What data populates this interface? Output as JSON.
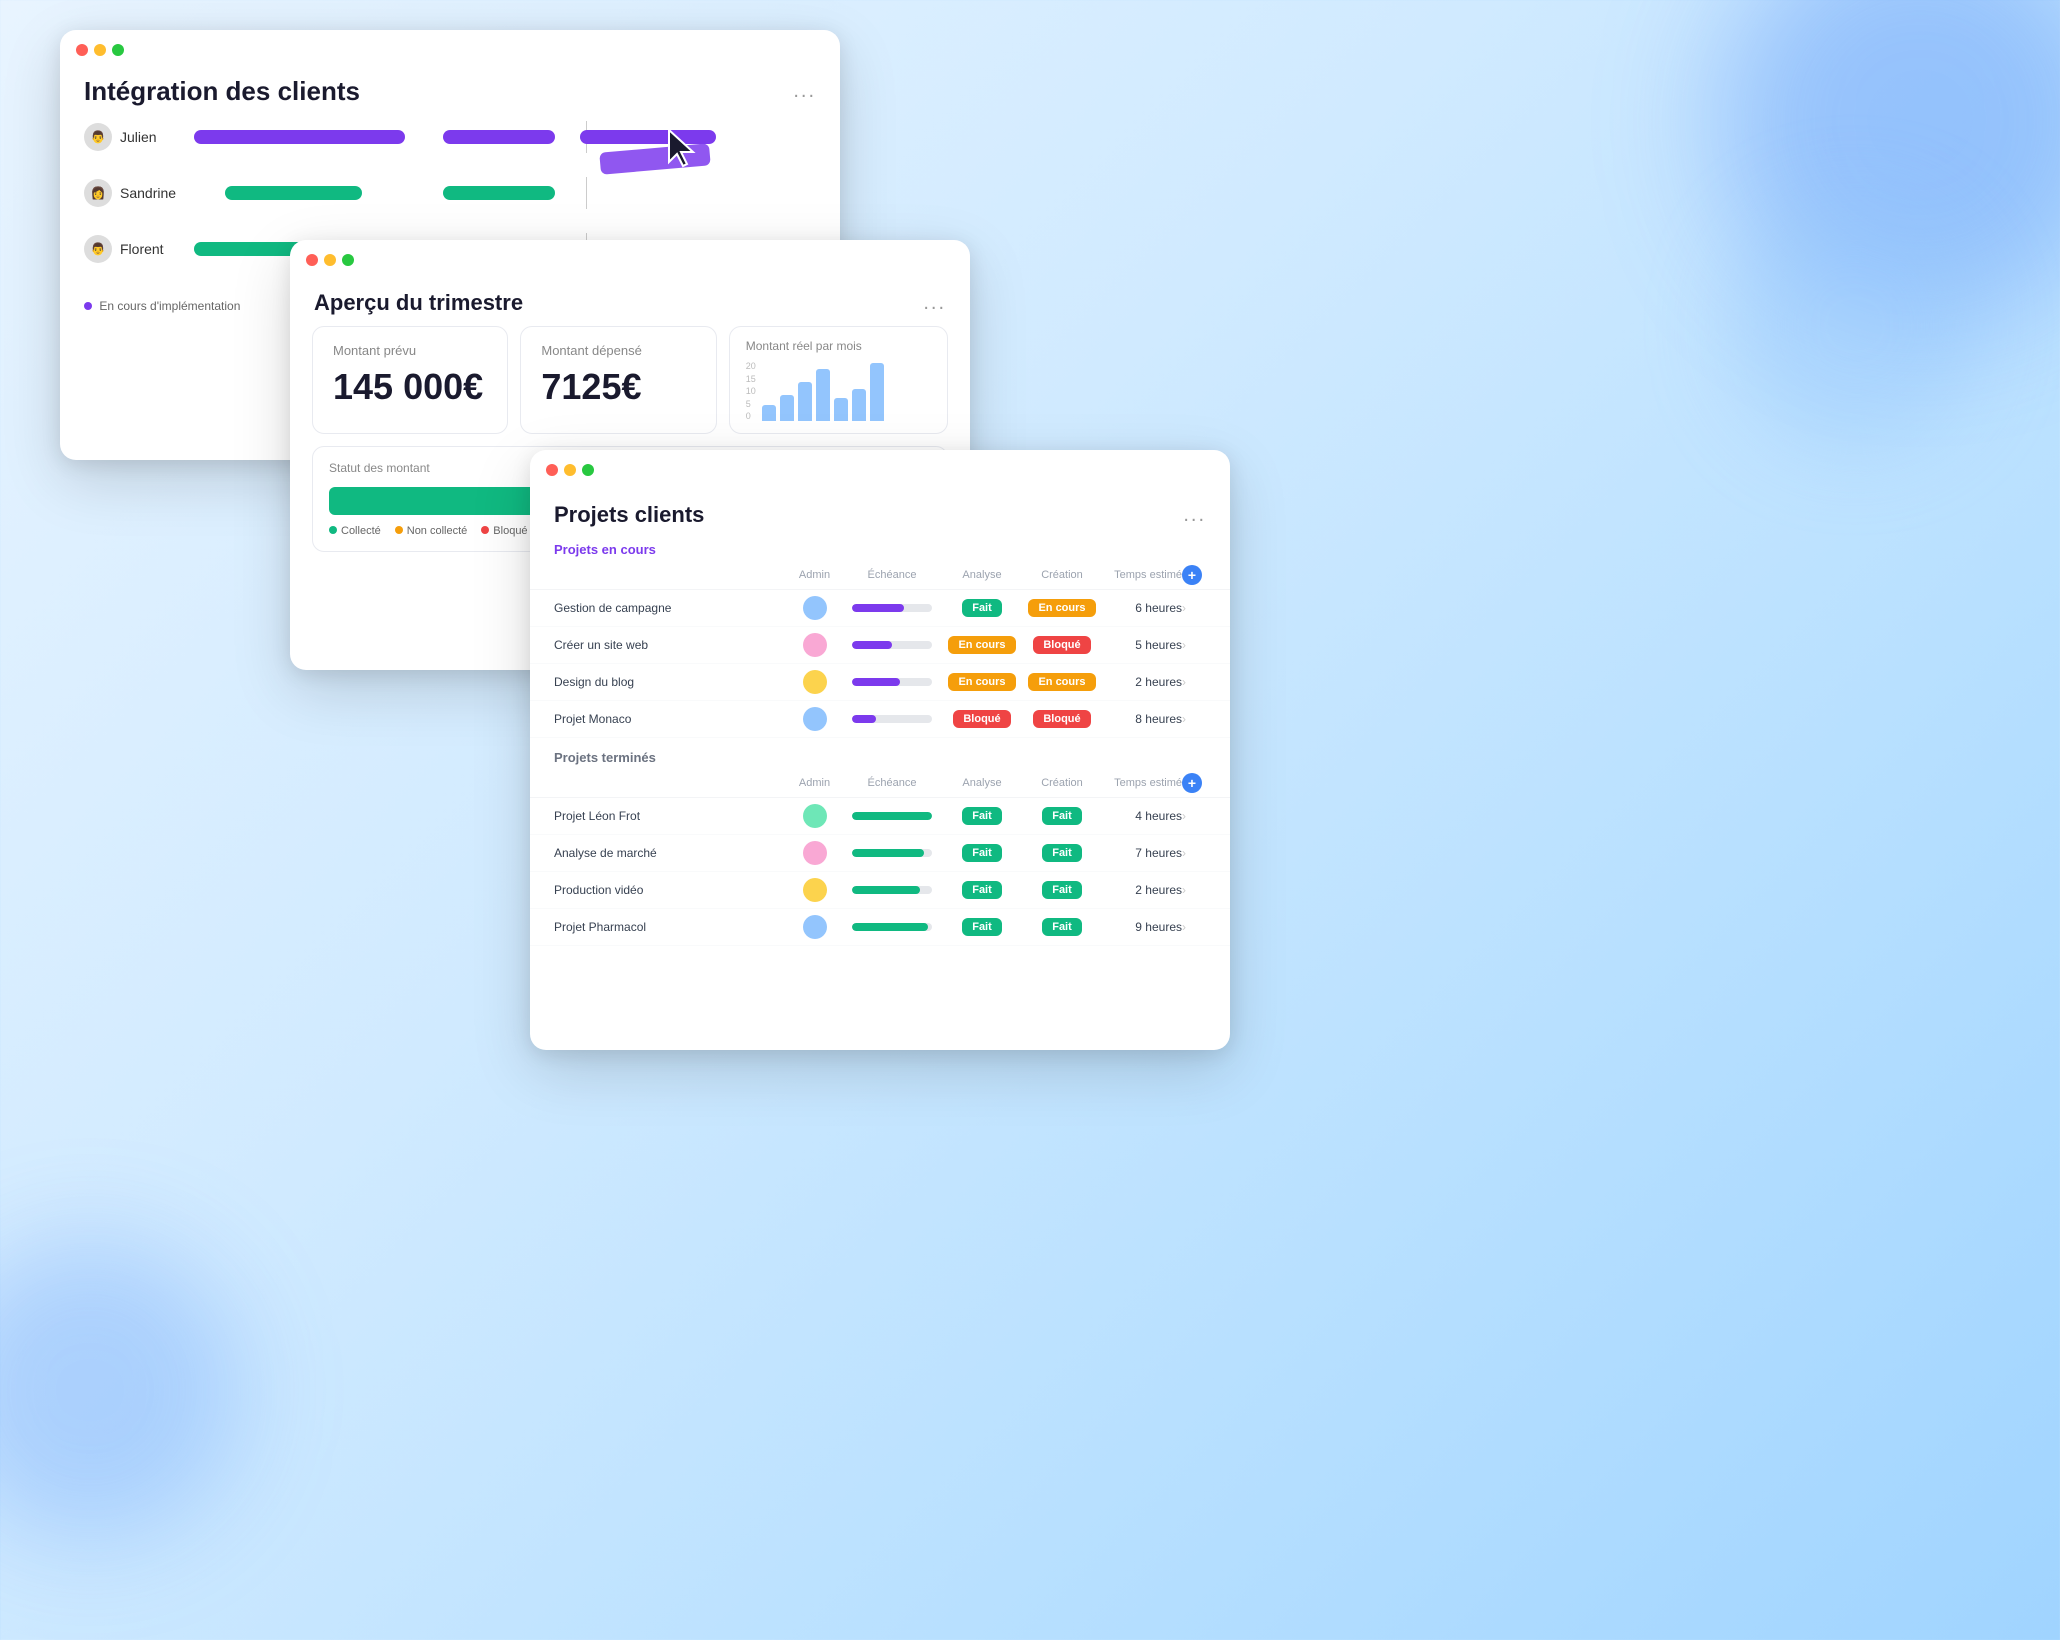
{
  "gantt": {
    "title": "Intégration des clients",
    "more": "...",
    "rows": [
      {
        "name": "Julien",
        "bars": [
          {
            "left": "0%",
            "width": "34%",
            "color": "purple"
          },
          {
            "left": "40%",
            "width": "18%",
            "color": "purple"
          },
          {
            "left": "62%",
            "width": "22%",
            "color": "purple"
          }
        ]
      },
      {
        "name": "Sandrine",
        "bars": [
          {
            "left": "5%",
            "width": "22%",
            "color": "green"
          },
          {
            "left": "40%",
            "width": "18%",
            "color": "green"
          }
        ]
      },
      {
        "name": "Florent",
        "bars": [
          {
            "left": "0%",
            "width": "20%",
            "color": "green"
          }
        ]
      }
    ],
    "legend": [
      {
        "color": "#7c3aed",
        "label": "En cours d'implémentation"
      },
      {
        "color": "#10b981",
        "label": ""
      }
    ]
  },
  "apercu": {
    "title": "Aperçu du trimestre",
    "more": "...",
    "montant_prevu_label": "Montant prévu",
    "montant_prevu_value": "145 000€",
    "montant_depense_label": "Montant dépensé",
    "montant_depense_value": "7125€",
    "chart_label": "Montant réel par mois",
    "chart_bars": [
      5,
      8,
      12,
      16,
      7,
      10,
      18
    ],
    "chart_y_labels": [
      "20",
      "15",
      "10",
      "5",
      "0"
    ],
    "statut_label": "Statut des montant",
    "statut_segments": [
      {
        "color": "green",
        "width": "55%"
      },
      {
        "color": "orange",
        "width": "28%"
      },
      {
        "color": "red",
        "width": "17%"
      }
    ],
    "statut_legend": [
      {
        "color": "#10b981",
        "label": "Collecté"
      },
      {
        "color": "#f59e0b",
        "label": "Non collecté"
      },
      {
        "color": "#ef4444",
        "label": "Bloqué"
      }
    ]
  },
  "projets": {
    "title": "Projets clients",
    "more": "...",
    "columns": [
      "Admin",
      "Échéance",
      "Analyse",
      "Création",
      "Temps estimé"
    ],
    "active_section_label": "Projets en cours",
    "active_rows": [
      {
        "name": "Gestion de campagne",
        "avatar": "blue",
        "echeance_pct": 65,
        "analyse": "Fait",
        "analyse_color": "green",
        "creation": "En cours",
        "creation_color": "orange",
        "temps": "6 heures"
      },
      {
        "name": "Créer un site web",
        "avatar": "pink",
        "echeance_pct": 50,
        "analyse": "En cours",
        "analyse_color": "orange",
        "creation": "Bloqué",
        "creation_color": "red",
        "temps": "5 heures"
      },
      {
        "name": "Design du blog",
        "avatar": "orange",
        "echeance_pct": 60,
        "analyse": "En cours",
        "analyse_color": "orange",
        "creation": "En cours",
        "creation_color": "orange",
        "temps": "2 heures"
      },
      {
        "name": "Projet Monaco",
        "avatar": "blue",
        "echeance_pct": 30,
        "analyse": "Bloqué",
        "analyse_color": "red",
        "creation": "Bloqué",
        "creation_color": "red",
        "temps": "8 heures"
      }
    ],
    "completed_section_label": "Projets terminés",
    "completed_rows": [
      {
        "name": "Projet Léon Frot",
        "avatar": "teal",
        "echeance_pct": 100,
        "analyse": "Fait",
        "analyse_color": "green",
        "creation": "Fait",
        "creation_color": "green",
        "temps": "4 heures"
      },
      {
        "name": "Analyse de marché",
        "avatar": "pink",
        "echeance_pct": 90,
        "analyse": "Fait",
        "analyse_color": "green",
        "creation": "Fait",
        "creation_color": "green",
        "temps": "7 heures"
      },
      {
        "name": "Production vidéo",
        "avatar": "orange",
        "echeance_pct": 85,
        "analyse": "Fait",
        "analyse_color": "green",
        "creation": "Fait",
        "creation_color": "green",
        "temps": "2 heures"
      },
      {
        "name": "Projet Pharmacol",
        "avatar": "blue",
        "echeance_pct": 95,
        "analyse": "Fait",
        "analyse_color": "green",
        "creation": "Fait",
        "creation_color": "green",
        "temps": "9 heures"
      }
    ]
  }
}
